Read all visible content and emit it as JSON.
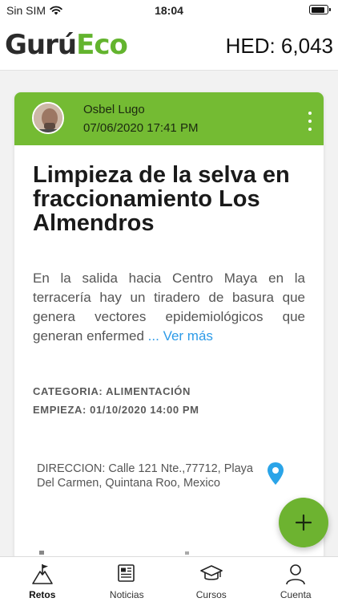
{
  "status_bar": {
    "carrier": "Sin SIM",
    "time": "18:04",
    "battery_level": 0.85
  },
  "header": {
    "logo_part1": "Gurú",
    "logo_part2": "Eco",
    "balance": "HED: 6,043"
  },
  "post": {
    "author": "Osbel Lugo",
    "date": "07/06/2020 17:41 PM",
    "title": "Limpieza de la selva en fraccionamiento Los Almendros",
    "description": "En la salida hacia Centro Maya en la terracería hay un tiradero de basura que genera vectores epidemiológicos que generan enfermed",
    "more_link": "... Ver más",
    "category": "CATEGORIA: ALIMENTACIÓN",
    "starts": "EMPIEZA: 01/10/2020 14:00 PM",
    "address": "DIRECCION: Calle 121 Nte.,77712, Playa Del Carmen, Quintana Roo, Mexico"
  },
  "fab_icon": "plus-icon",
  "tabs": [
    {
      "label": "Retos",
      "icon": "mountain-flag-icon",
      "active": true
    },
    {
      "label": "Noticias",
      "icon": "newspaper-icon",
      "active": false
    },
    {
      "label": "Cursos",
      "icon": "graduation-cap-icon",
      "active": false
    },
    {
      "label": "Cuenta",
      "icon": "user-icon",
      "active": false
    }
  ],
  "colors": {
    "brand_green": "#74bb33",
    "fab_green": "#6db330",
    "link_blue": "#2d9be8",
    "logo_dark": "#2b2b2b"
  }
}
